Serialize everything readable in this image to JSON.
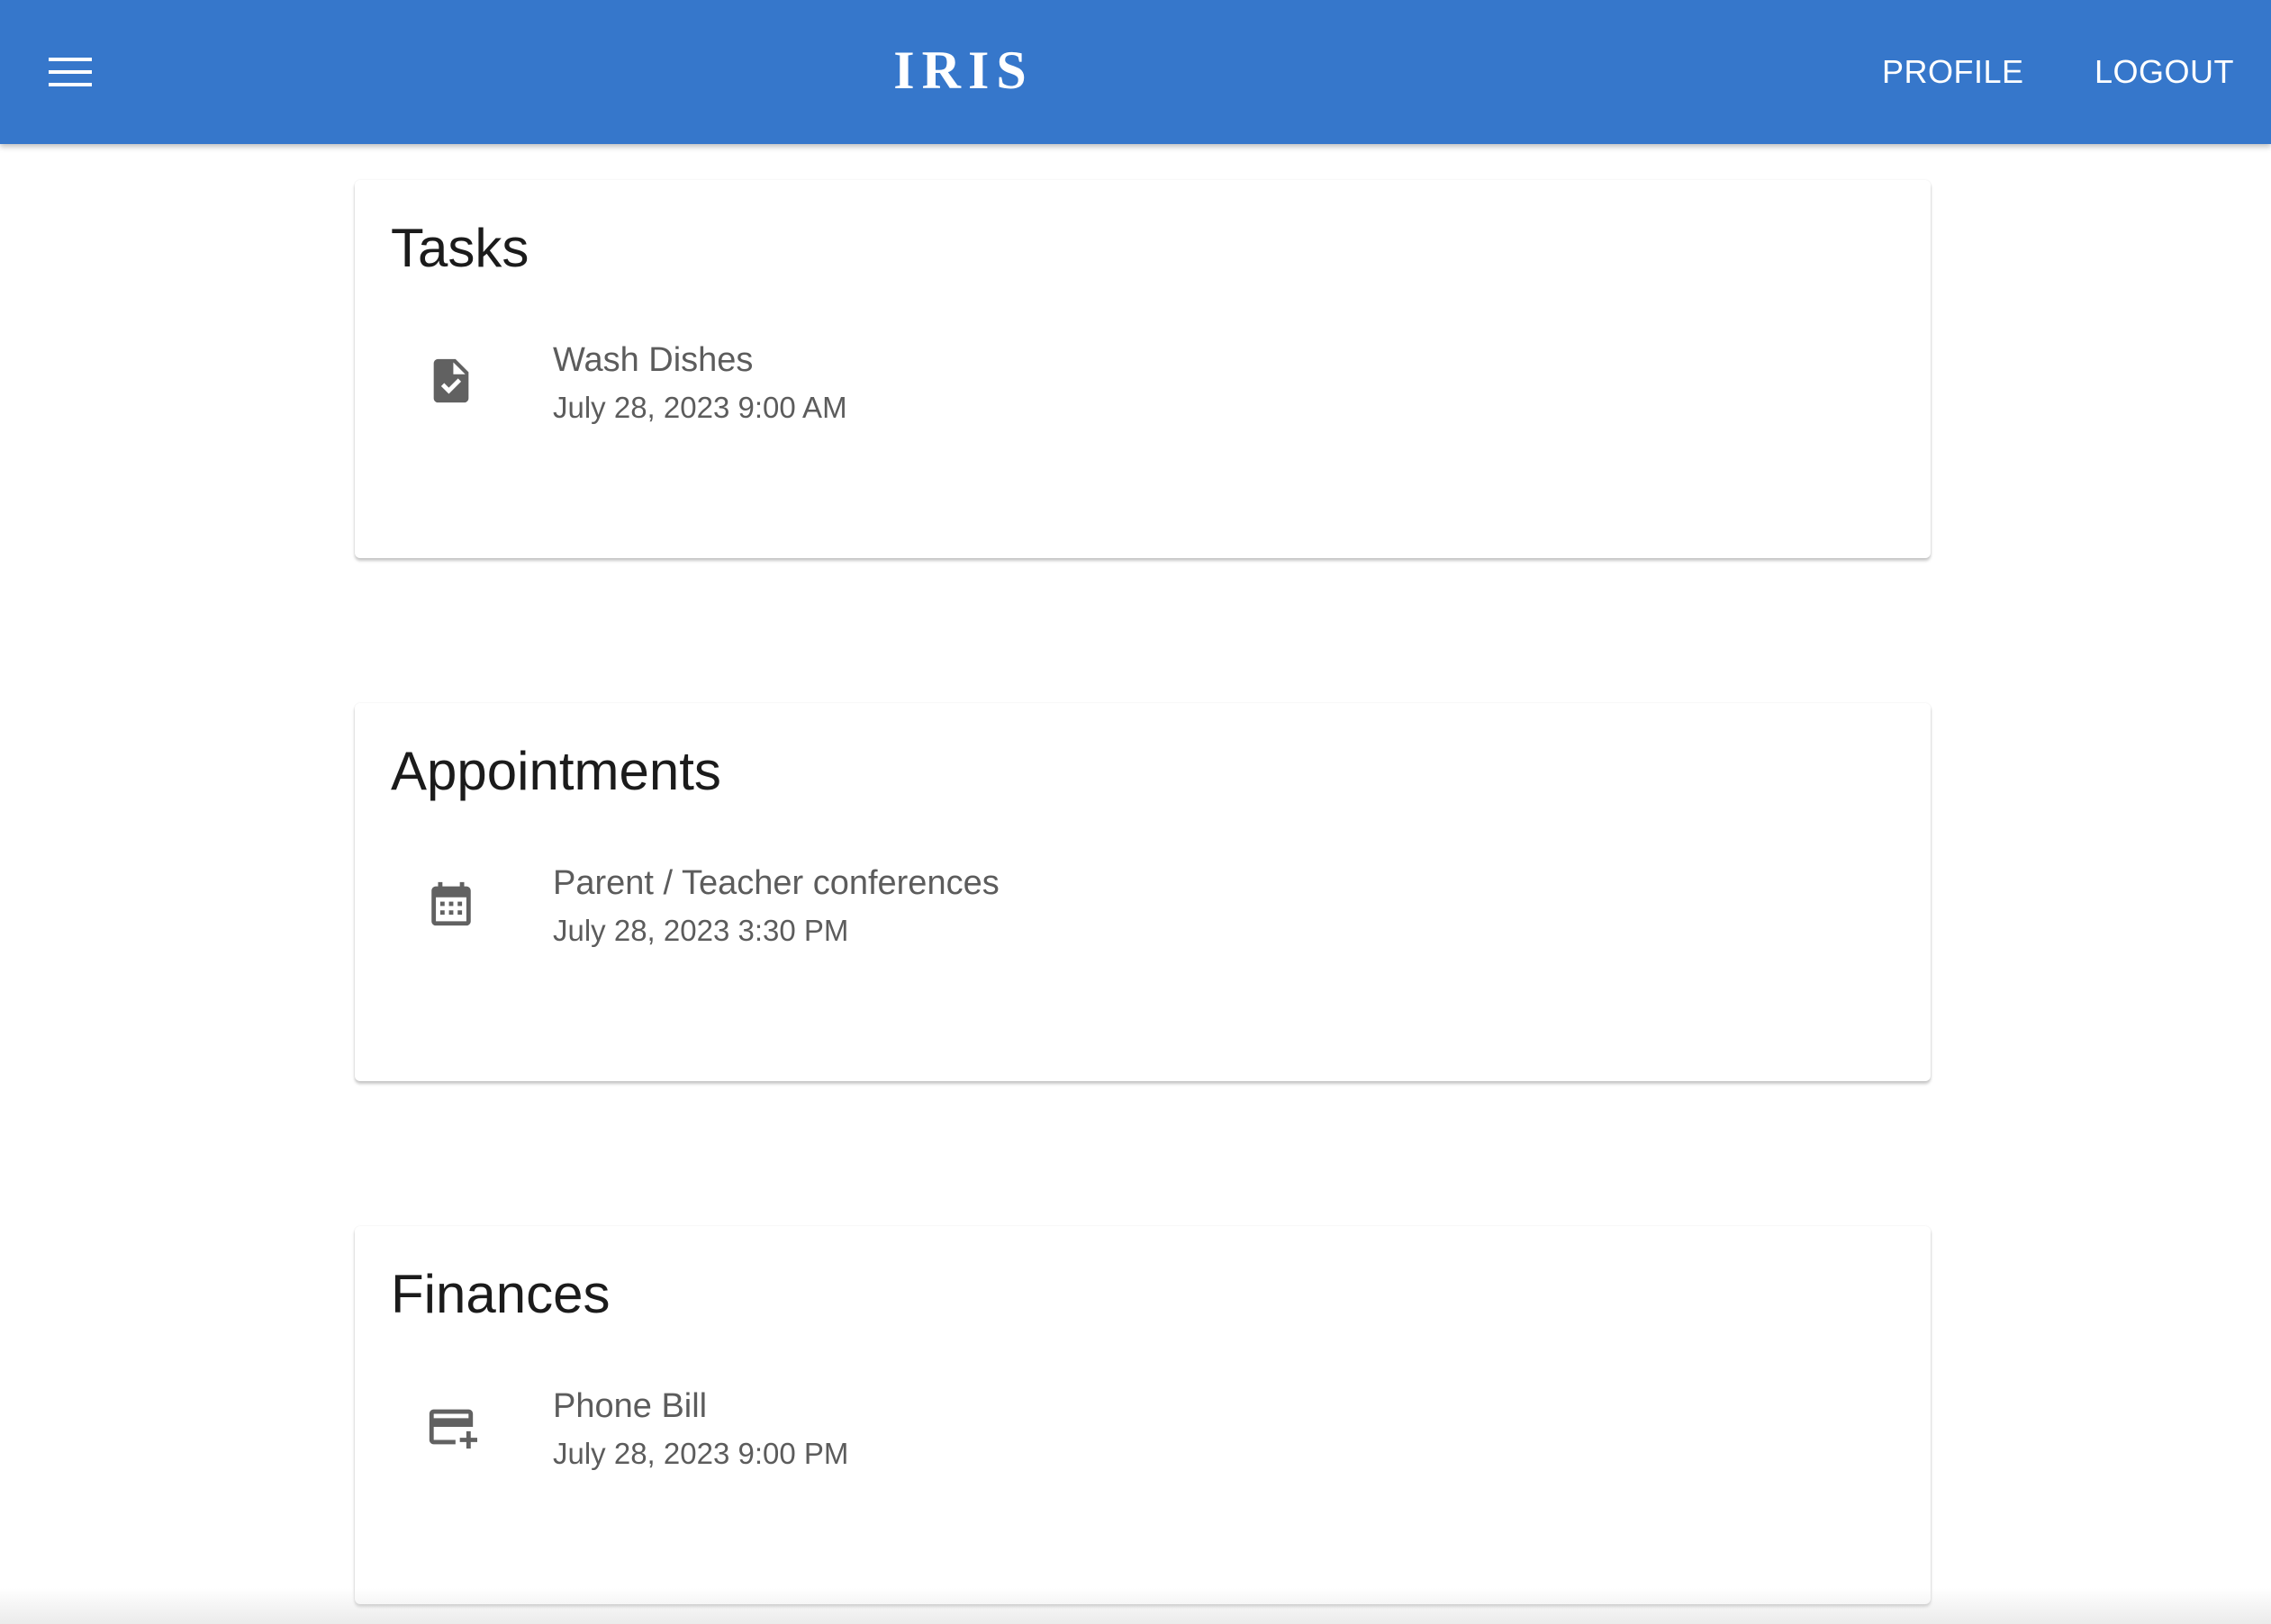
{
  "header": {
    "brand": "IRIS",
    "menu_icon": "menu-icon",
    "profile_label": "PROFILE",
    "logout_label": "LOGOUT",
    "bar_color": "#3677cb"
  },
  "sections": {
    "tasks": {
      "title": "Tasks",
      "items": [
        {
          "icon": "task-file-check-icon",
          "primary": "Wash Dishes",
          "secondary": "July 28, 2023 9:00 AM"
        }
      ]
    },
    "appointments": {
      "title": "Appointments",
      "items": [
        {
          "icon": "calendar-icon",
          "primary": "Parent / Teacher conferences",
          "secondary": "July 28, 2023 3:30 PM"
        }
      ]
    },
    "finances": {
      "title": "Finances",
      "items": [
        {
          "icon": "credit-card-add-icon",
          "primary": "Phone Bill",
          "secondary": "July 28, 2023 9:00 PM"
        }
      ]
    }
  }
}
